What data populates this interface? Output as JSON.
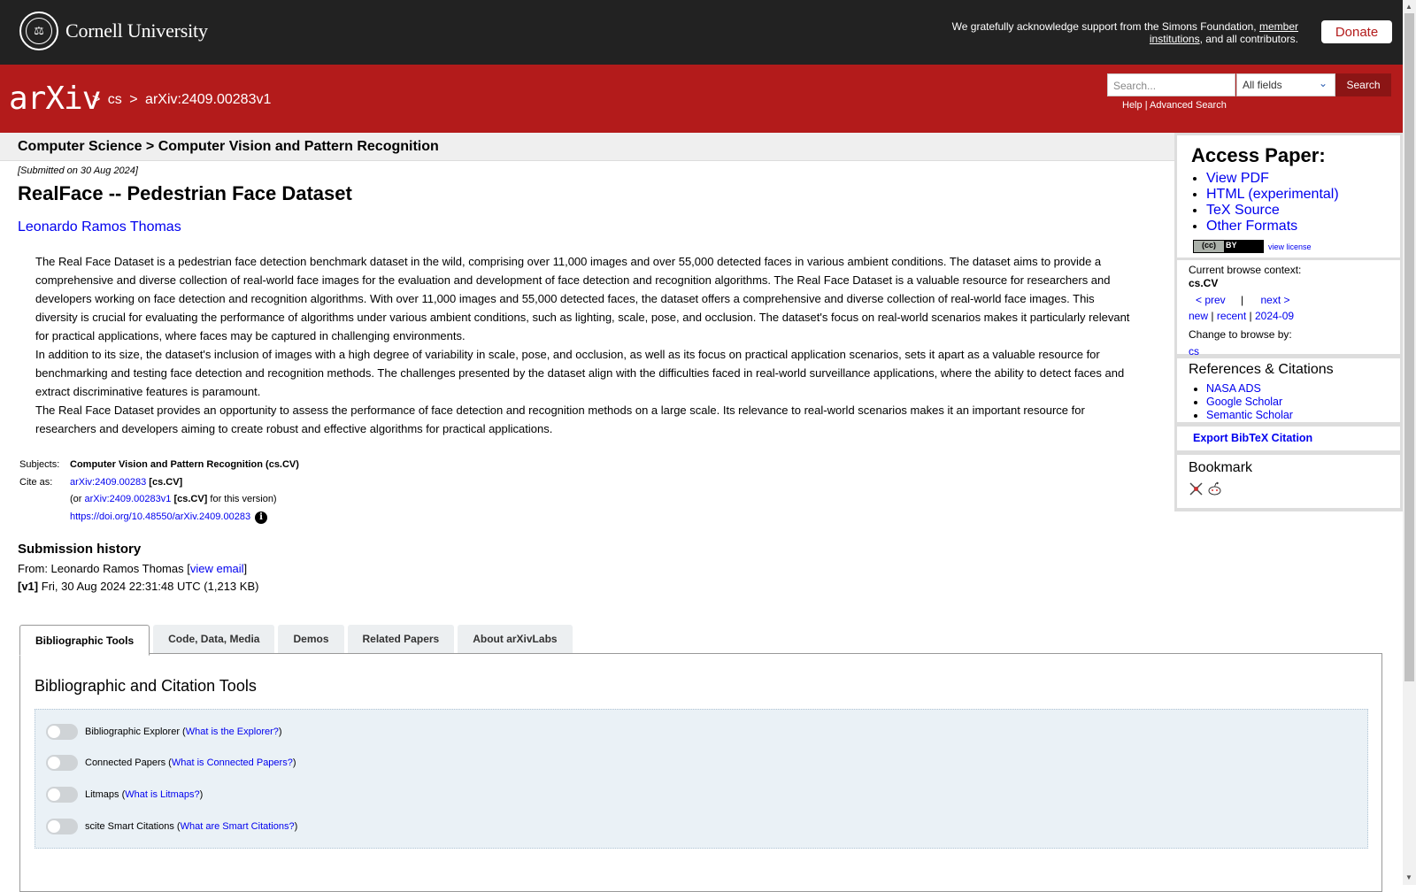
{
  "topbar": {
    "cornell_name": "Cornell University",
    "ack_text": "We gratefully acknowledge support from the Simons Foundation,",
    "ack_link": "member institutions",
    "ack_tail": ", and all contributors.",
    "donate_label": "Donate"
  },
  "header": {
    "logo_text": "arXiv",
    "breadcrumb_sep": ">",
    "breadcrumb_cs": "cs",
    "breadcrumb_id": "arXiv:2409.00283v1",
    "search_placeholder": "Search...",
    "search_field": "All fields",
    "search_button": "Search",
    "help_label": "Help",
    "help_sep": "|",
    "advanced_label": "Advanced Search"
  },
  "main": {
    "subject_header": "Computer Science > Computer Vision and Pattern Recognition",
    "submitted": "[Submitted on 30 Aug 2024]",
    "title": "RealFace -- Pedestrian Face Dataset",
    "author": "Leonardo Ramos Thomas",
    "abstract": [
      "The Real Face Dataset is a pedestrian face detection benchmark dataset in the wild, comprising over 11,000 images and over 55,000 detected faces in various ambient conditions. The dataset aims to provide a comprehensive and diverse collection of real-world face images for the evaluation and development of face detection and recognition algorithms. The Real Face Dataset is a valuable resource for researchers and developers working on face detection and recognition algorithms. With over 11,000 images and 55,000 detected faces, the dataset offers a comprehensive and diverse collection of real-world face images. This diversity is crucial for evaluating the performance of algorithms under various ambient conditions, such as lighting, scale, pose, and occlusion. The dataset's focus on real-world scenarios makes it particularly relevant for practical applications, where faces may be captured in challenging environments.",
      "In addition to its size, the dataset's inclusion of images with a high degree of variability in scale, pose, and occlusion, as well as its focus on practical application scenarios, sets it apart as a valuable resource for benchmarking and testing face detection and recognition methods. The challenges presented by the dataset align with the difficulties faced in real-world surveillance applications, where the ability to detect faces and extract discriminative features is paramount.",
      "The Real Face Dataset provides an opportunity to assess the performance of face detection and recognition methods on a large scale. Its relevance to real-world scenarios makes it an important resource for researchers and developers aiming to create robust and effective algorithms for practical applications."
    ],
    "subjects_label": "Subjects:",
    "subjects_value": "Computer Vision and Pattern Recognition (cs.CV)",
    "cite_label": "Cite as:",
    "cite_id": "arXiv:2409.00283",
    "cite_cat": "[cs.CV]",
    "cite_or": "(or",
    "cite_version_id": "arXiv:2409.00283v1",
    "cite_version_cat": "[cs.CV]",
    "cite_version_tail": "for this version)",
    "doi": "https://doi.org/10.48550/arXiv.2409.00283",
    "info_icon_glyph": "i",
    "history_title": "Submission history",
    "history_from_prefix": "From: Leonardo Ramos Thomas [",
    "history_view_email": "view email",
    "history_from_suffix": "]",
    "history_v1_tag": "[v1]",
    "history_v1_text": "Fri, 30 Aug 2024 22:31:48 UTC (1,213 KB)"
  },
  "tabs": [
    {
      "label": "Bibliographic Tools",
      "active": true
    },
    {
      "label": "Code, Data, Media",
      "active": false
    },
    {
      "label": "Demos",
      "active": false
    },
    {
      "label": "Related Papers",
      "active": false
    },
    {
      "label": "About arXivLabs",
      "active": false
    }
  ],
  "tools_panel": {
    "title": "Bibliographic and Citation Tools",
    "items": [
      {
        "label": "Bibliographic Explorer",
        "link": "What is the Explorer?",
        "enabled": false
      },
      {
        "label": "Connected Papers",
        "link": "What is Connected Papers?",
        "enabled": false
      },
      {
        "label": "Litmaps",
        "link": "What is Litmaps?",
        "enabled": false
      },
      {
        "label": "scite Smart Citations",
        "link": "What are Smart Citations?",
        "enabled": false
      }
    ]
  },
  "sidebar": {
    "access_title": "Access Paper:",
    "access_links": [
      "View PDF",
      "HTML (experimental)",
      "TeX Source",
      "Other Formats"
    ],
    "license_badge_left": "(cc)",
    "license_badge_right": "BY",
    "view_license": "view license",
    "context_label": "Current browse context:",
    "context_value": "cs.CV",
    "prev": "< prev",
    "nav_sep": "|",
    "next": "next >",
    "new": "new",
    "recent": "recent",
    "month": "2024-09",
    "change_label": "Change to browse by:",
    "change_value": "cs",
    "refs_title": "References & Citations",
    "refs": [
      "NASA ADS",
      "Google Scholar",
      "Semantic Scholar"
    ],
    "export_bibtex": "Export BibTeX Citation",
    "bookmark_title": "Bookmark"
  },
  "colors": {
    "arxiv_red": "#b31b1b",
    "topbar": "#222222",
    "link": "#0000ee"
  }
}
